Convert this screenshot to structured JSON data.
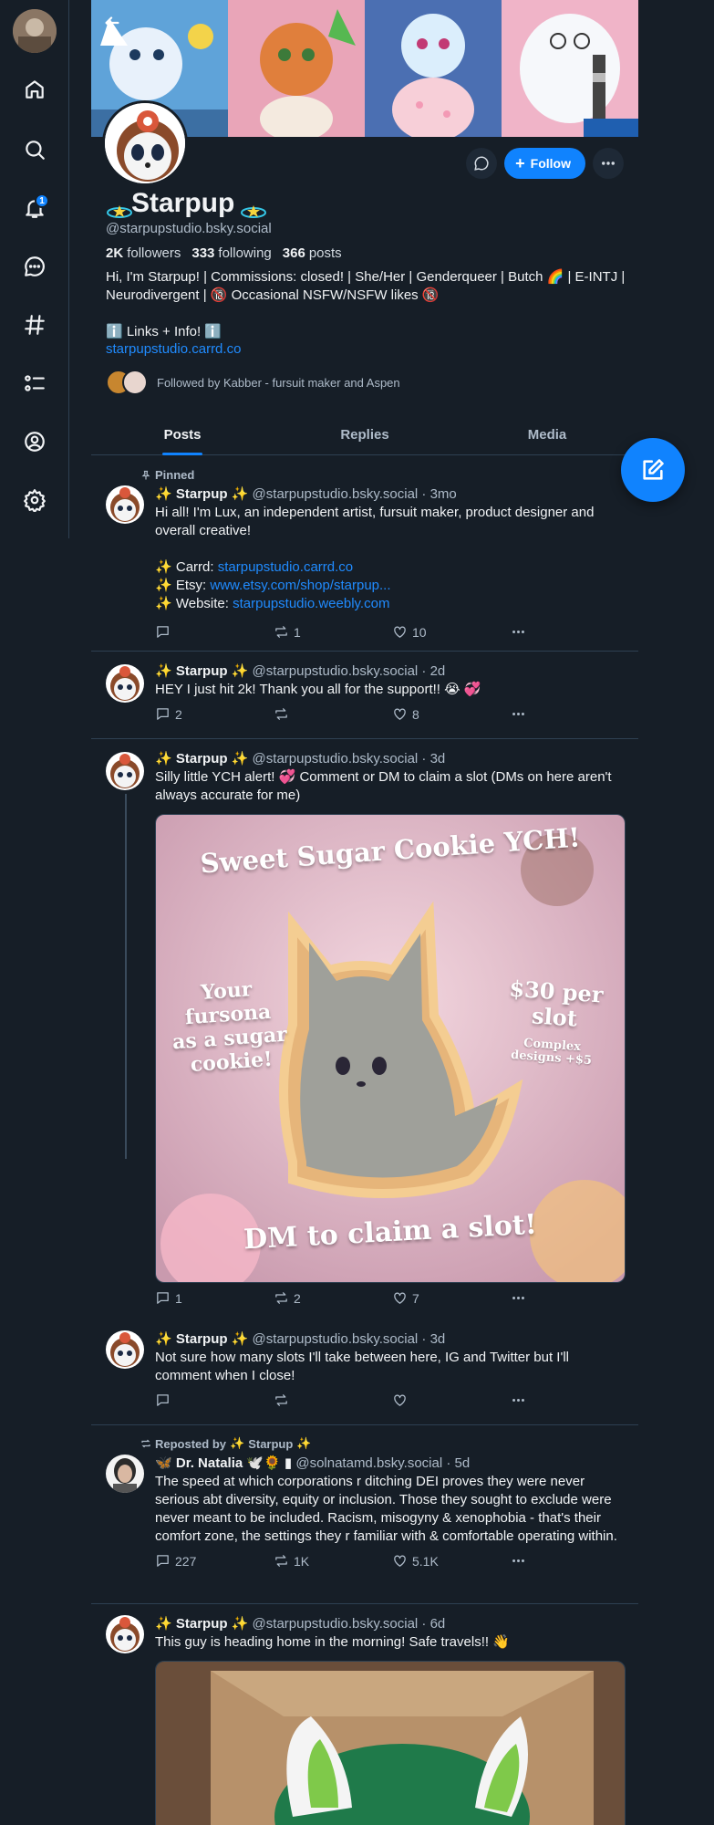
{
  "nav": {
    "notification_count": "1",
    "items": [
      "home",
      "search",
      "notifications",
      "chat",
      "feeds",
      "lists",
      "profile",
      "settings"
    ]
  },
  "profile": {
    "display_name": "Starpup",
    "handle": "@starpupstudio.bsky.social",
    "followers_count": "2K",
    "followers_label": "followers",
    "following_count": "333",
    "following_label": "following",
    "posts_count": "366",
    "posts_label": "posts",
    "bio_line1": "Hi, I'm Starpup! | Commissions: closed! | She/Her | Genderqueer | Butch 🌈 | E-INTJ | Neurodivergent | 🔞 Occasional NSFW/NSFW likes 🔞",
    "bio_line2": "ℹ️ Links + Info! ℹ️",
    "link": "starpupstudio.carrd.co",
    "followed_by": "Followed by Kabber - fursuit maker and Aspen",
    "follow_label": "Follow"
  },
  "tabs": [
    "Posts",
    "Replies",
    "Media"
  ],
  "posts": [
    {
      "pinned_label": "Pinned",
      "name": "Starpup",
      "handle": "@starpupstudio.bsky.social",
      "time": "· 3mo",
      "text": "Hi all! I'm Lux, an independent artist, fursuit maker, product designer and overall creative!",
      "links": [
        {
          "label": "Carrd:",
          "url": "starpupstudio.carrd.co"
        },
        {
          "label": "Etsy:",
          "url": "www.etsy.com/shop/starpup..."
        },
        {
          "label": "Website:",
          "url": "starpupstudio.weebly.com"
        }
      ],
      "replies": "",
      "reposts": "1",
      "likes": "10"
    },
    {
      "name": "Starpup",
      "handle": "@starpupstudio.bsky.social",
      "time": "· 2d",
      "text": "HEY I just hit 2k! Thank you all for the support!! 😭 💞",
      "replies": "2",
      "reposts": "",
      "likes": "8"
    },
    {
      "name": "Starpup",
      "handle": "@starpupstudio.bsky.social",
      "time": "· 3d",
      "text": "Silly little YCH alert! 💞 Comment or DM to claim a slot (DMs on here aren't always accurate for me)",
      "image": {
        "title": "Sweet Sugar Cookie YCH!",
        "left_text": "Your fursona as a sugar cookie!",
        "right_price": "$30 per slot",
        "right_note": "Complex designs +$5",
        "bottom_text": "DM to claim a slot!"
      },
      "replies": "1",
      "reposts": "2",
      "likes": "7"
    },
    {
      "name": "Starpup",
      "handle": "@starpupstudio.bsky.social",
      "time": "· 3d",
      "text": "Not sure how many slots I'll take between here, IG and Twitter but I'll comment when I close!",
      "replies": "",
      "reposts": "",
      "likes": ""
    },
    {
      "repost_label": "Reposted by",
      "repost_by": "Starpup",
      "name": "Dr. Natalia 🕊️🌻 ▮",
      "handle": "@solnatamd.bsky.social",
      "time": "· 5d",
      "text": "The speed at which corporations r ditching DEI proves they were never serious abt diversity, equity or inclusion. Those they sought to exclude were never meant to be included. Racism, misogyny & xenophobia - that's their comfort zone, the settings they r familiar with & comfortable operating within.",
      "replies": "227",
      "reposts": "1K",
      "likes": "5.1K"
    },
    {
      "name": "Starpup",
      "handle": "@starpupstudio.bsky.social",
      "time": "· 6d",
      "text": "This guy is heading home in the morning! Safe travels!! 👋"
    }
  ],
  "colors": {
    "background": "#161e27",
    "accent": "#1083fe",
    "link": "#208bfe",
    "muted": "#aebbc9",
    "border": "#2e4052"
  }
}
